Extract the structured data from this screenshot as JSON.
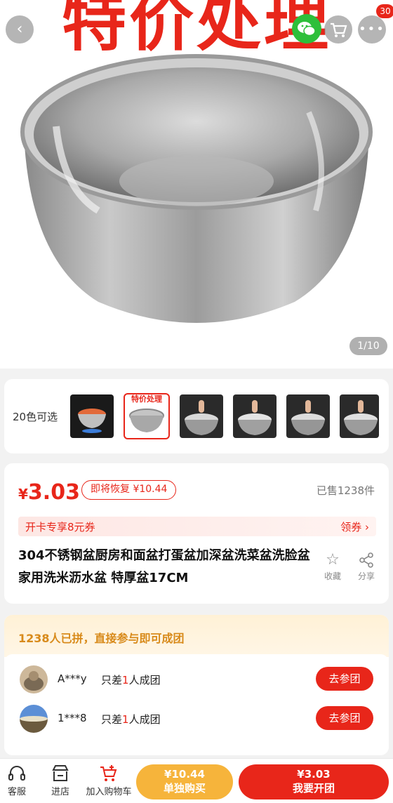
{
  "hero": {
    "banner_text": "特价处理",
    "page_counter": "1/10"
  },
  "header": {
    "back_icon": "chevron-left-icon",
    "wechat_icon": "wechat-icon",
    "cart_icon": "cart-icon",
    "cart_badge": "30",
    "more_icon": "more-dots-icon"
  },
  "variants": {
    "label": "20色可选",
    "thumbnails": [
      {
        "name": "thumb-bowl-with-food"
      },
      {
        "name": "thumb-special-offer-bowl",
        "caption": "特价处理"
      },
      {
        "name": "thumb-bowl-with-strainer-1"
      },
      {
        "name": "thumb-bowl-with-strainer-2"
      },
      {
        "name": "thumb-bowl-with-strainer-3"
      },
      {
        "name": "thumb-bowl-with-strainer-4"
      }
    ]
  },
  "price": {
    "currency": "¥",
    "value": "3.03",
    "restore_badge": "即将恢复 ¥10.44",
    "sold": "已售1238件",
    "coupon_text": "开卡专享8元券",
    "coupon_link": "领券 ›",
    "title": "304不锈钢盆厨房和面盆打蛋盆加深盆洗菜盆洗脸盆家用洗米沥水盆 特厚盆17CM",
    "favorite_label": "收藏",
    "share_label": "分享"
  },
  "group": {
    "header": "1238人已拼，直接参与即可成团",
    "rows": [
      {
        "user": "A***y",
        "needs_prefix": "只差",
        "needs_count": "1",
        "needs_suffix": "人成团",
        "button": "去参团"
      },
      {
        "user": "1***8",
        "needs_prefix": "只差",
        "needs_count": "1",
        "needs_suffix": "人成团",
        "button": "去参团"
      }
    ]
  },
  "bottom": {
    "service_label": "客服",
    "store_label": "进店",
    "cart_label": "加入购物车",
    "buy_alone_price": "¥10.44",
    "buy_alone_label": "单独购买",
    "buy_group_price": "¥3.03",
    "buy_group_label": "我要开团"
  },
  "colors": {
    "accent": "#e8261a",
    "orange": "#f6b43b",
    "group_header": "#d88a1a"
  }
}
